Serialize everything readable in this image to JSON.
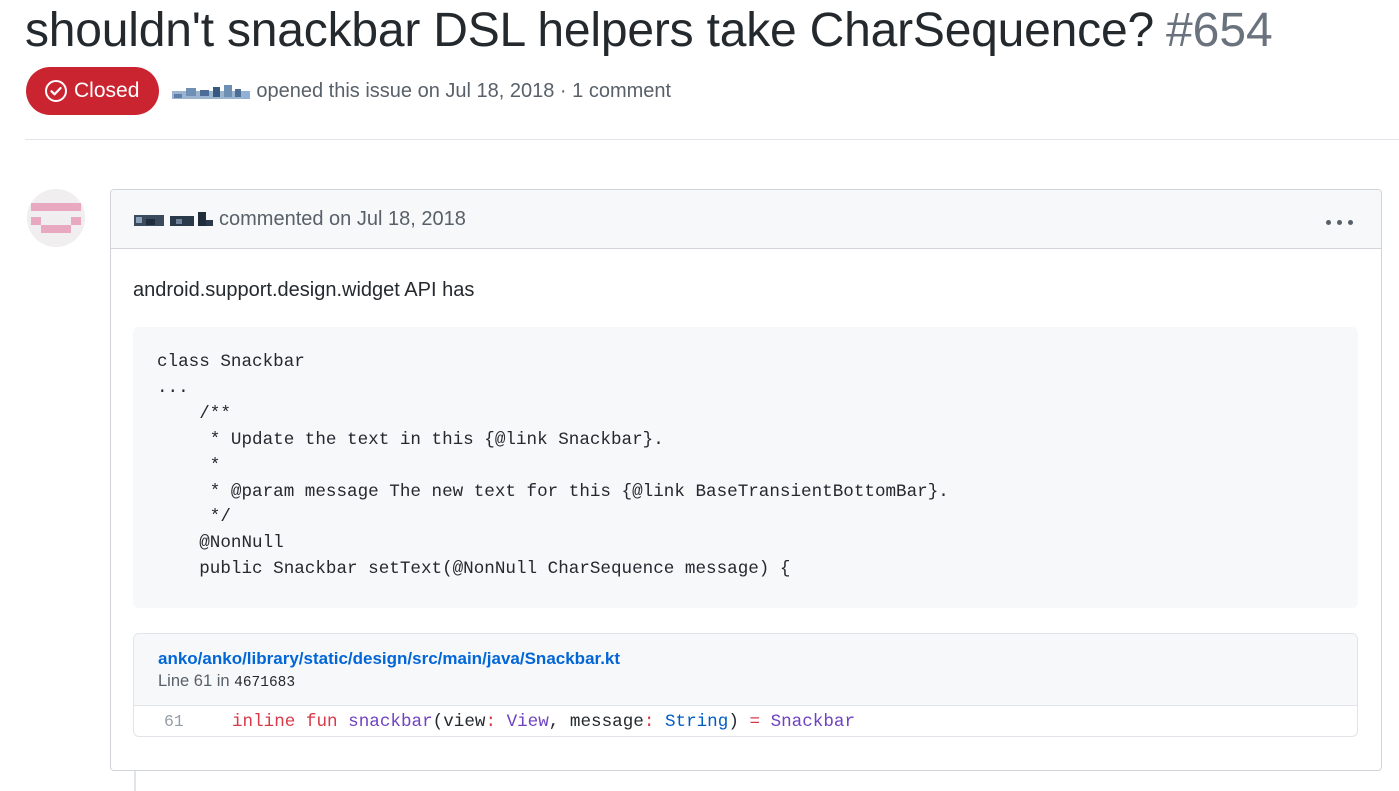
{
  "issue": {
    "title": "shouldn't snackbar DSL helpers take CharSequence?",
    "number": "#654",
    "state": "Closed",
    "meta": "opened this issue on Jul 18, 2018 · 1 comment"
  },
  "colors": {
    "closed_badge": "#cb2431",
    "link": "#0366d6",
    "keyword": "#d73a49",
    "function": "#6f42c1",
    "type_builtin": "#005cc5"
  },
  "comment": {
    "meta": "commented on Jul 18, 2018",
    "more_icon": "kebab-horizontal-icon",
    "body_text": "android.support.design.widget API has",
    "code": "class Snackbar\n...\n    /**\n     * Update the text in this {@link Snackbar}.\n     *\n     * @param message The new text for this {@link BaseTransientBottomBar}.\n     */\n    @NonNull\n    public Snackbar setText(@NonNull CharSequence message) {",
    "permalink": {
      "file_path": "anko/anko/library/static/design/src/main/java/Snackbar.kt",
      "line_label": "Line 61 in",
      "commit": "4671683",
      "line_number": "61",
      "tokens": {
        "inline": "inline",
        "fun": "fun",
        "name": "snackbar",
        "open": "(view",
        "colon1": ":",
        "type1": "View",
        "sep": ", message",
        "colon2": ":",
        "type2": "String",
        "close": ")",
        "eq": "=",
        "ret": "Snackbar"
      }
    }
  }
}
